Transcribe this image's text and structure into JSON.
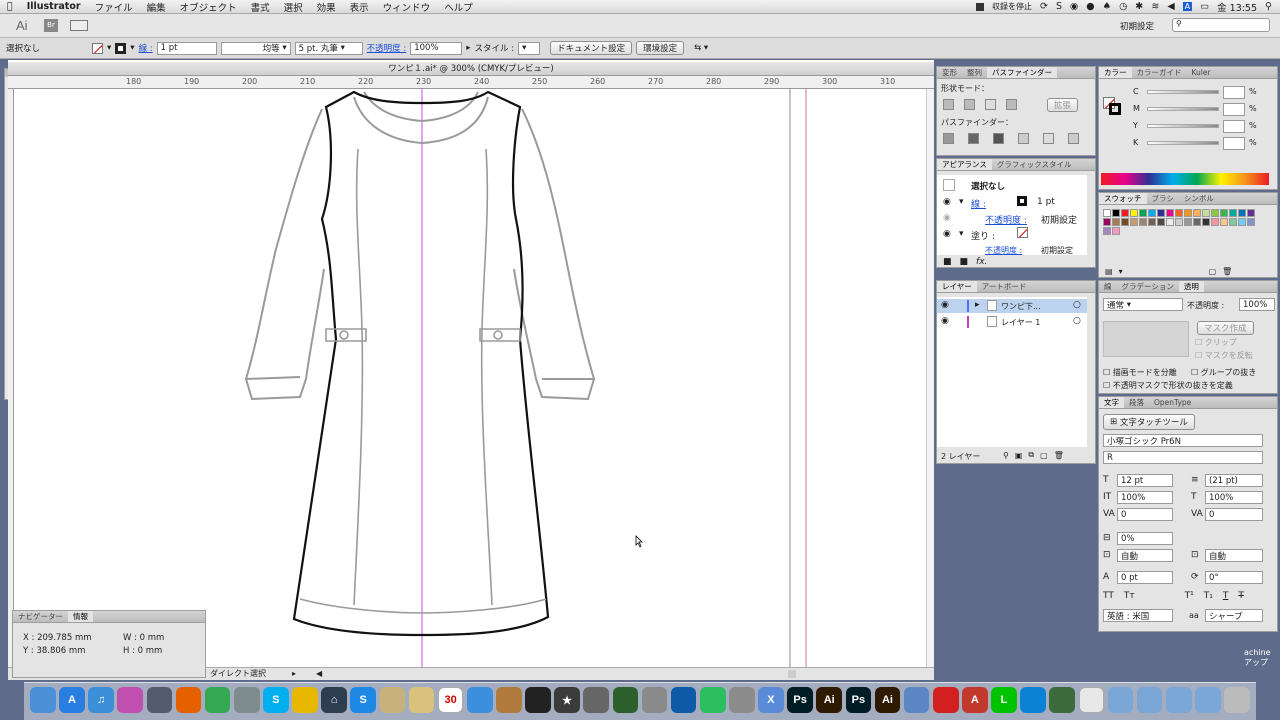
{
  "menubar": {
    "apple_icon": "apple-icon",
    "app": "Illustrator",
    "items": [
      "ファイル",
      "編集",
      "オブジェクト",
      "書式",
      "選択",
      "効果",
      "表示",
      "ウィンドウ",
      "ヘルプ"
    ],
    "recording": "収録を停止",
    "clock": "金 13:55"
  },
  "appbar": {
    "logo": "Ai",
    "workspace": "初期設定",
    "search_placeholder": ""
  },
  "control": {
    "selection": "選択なし",
    "stroke_label": "線 :",
    "stroke_value": "1 pt",
    "stroke_profile": "均等",
    "brush": "5 pt. 丸筆",
    "opacity_label": "不透明度 :",
    "opacity_value": "100%",
    "style_label": "スタイル :",
    "doc_setup": "ドキュメント設定",
    "prefs": "環境設定"
  },
  "document": {
    "title": "ワンピ１.ai* @ 300% (CMYK/プレビュー)",
    "ruler_ticks": [
      "180",
      "190",
      "200",
      "210",
      "220",
      "230",
      "240",
      "250",
      "260",
      "270",
      "280",
      "290",
      "300",
      "310"
    ],
    "status_tool": "ダイレクト選択"
  },
  "pathfinder": {
    "tabs": [
      "変形",
      "整列",
      "パスファインダー"
    ],
    "shape_modes": "形状モード：",
    "expand": "拡張",
    "pathfinders": "パスファインダー："
  },
  "appearance": {
    "tabs": [
      "アピアランス",
      "グラフィックスタイル"
    ],
    "header": "選択なし",
    "stroke_label": "線 :",
    "stroke_value": "1 pt",
    "opacity_label": "不透明度 :",
    "opacity_value": "初期設定",
    "fill_label": "塗り :",
    "opacity2_label": "不透明度 :",
    "opacity2_value": "初期設定"
  },
  "layers": {
    "tabs": [
      "レイヤー",
      "アートボード"
    ],
    "items": [
      {
        "name": "ワンピ下...",
        "color": "#4f6fff"
      },
      {
        "name": "レイヤー 1",
        "color": "#c040c0"
      }
    ],
    "count": "2 レイヤー"
  },
  "color": {
    "tabs": [
      "カラー",
      "カラーガイド",
      "Kuler"
    ],
    "channels": [
      {
        "label": "C",
        "unit": "%"
      },
      {
        "label": "M",
        "unit": "%"
      },
      {
        "label": "Y",
        "unit": "%"
      },
      {
        "label": "K",
        "unit": "%"
      }
    ]
  },
  "swatches": {
    "tabs": [
      "スウォッチ",
      "ブラシ",
      "シンボル"
    ],
    "colors": [
      "#ffffff",
      "#000000",
      "#ed1c24",
      "#fff200",
      "#00a651",
      "#00aeef",
      "#2e3192",
      "#ec008c",
      "#f26522",
      "#f7941d",
      "#fbaf5d",
      "#c4df9b",
      "#8dc63f",
      "#39b54a",
      "#00a99d",
      "#0072bc",
      "#662d91",
      "#9e005d",
      "#a67c52",
      "#754c24",
      "#c69c6d",
      "#998675",
      "#736357",
      "#534741",
      "#ebebeb",
      "#cccccc",
      "#999999",
      "#666666",
      "#333333",
      "#f5989d",
      "#fdc689",
      "#82ca9c",
      "#6dcff6",
      "#8493ca",
      "#a186be",
      "#f49ac1"
    ]
  },
  "transparency": {
    "tabs": [
      "線",
      "グラデーション",
      "透明"
    ],
    "mode": "通常",
    "opacity_label": "不透明度 :",
    "opacity_value": "100%",
    "make_mask": "マスク作成",
    "clip": "クリップ",
    "invert": "マスクを反転",
    "isolate": "描画モードを分離",
    "knockout": "グループの抜き",
    "define": "不透明マスクで形状の抜きを定義"
  },
  "character": {
    "tabs": [
      "文字",
      "段落",
      "OpenType"
    ],
    "touch_tool": "文字タッチツール",
    "font": "小塚ゴシック Pr6N",
    "weight": "R",
    "size": "12 pt",
    "leading": "(21 pt)",
    "vscale": "100%",
    "hscale": "100%",
    "kern": "0",
    "track": "0",
    "tsume": "0%",
    "aki1": "自動",
    "aki2": "自動",
    "baseline": "0 pt",
    "rotate": "0°",
    "lang": "英語 : 米国",
    "aa": "シャープ"
  },
  "info": {
    "tabs": [
      "ナビゲーター",
      "情報"
    ],
    "x": "X : 209.785 mm",
    "y": "Y : 38.806 mm",
    "w": "W : 0 mm",
    "h": "H : 0 mm"
  },
  "dock": {
    "icons": [
      {
        "name": "finder-icon",
        "color": "#4a90d9",
        "t": ""
      },
      {
        "name": "appstore-icon",
        "color": "#2a7de1",
        "t": "A"
      },
      {
        "name": "itunes-icon",
        "color": "#3a8fd8",
        "t": "♫"
      },
      {
        "name": "printer-icon",
        "color": "#c04fb0",
        "t": ""
      },
      {
        "name": "launchpad-icon",
        "color": "#555b6e",
        "t": ""
      },
      {
        "name": "firefox-icon",
        "color": "#e66000",
        "t": ""
      },
      {
        "name": "chrome-icon",
        "color": "#34a853",
        "t": ""
      },
      {
        "name": "preview-icon",
        "color": "#7f8c8d",
        "t": ""
      },
      {
        "name": "skype-icon",
        "color": "#00aff0",
        "t": "S"
      },
      {
        "name": "cyberduck-icon",
        "color": "#e8b800",
        "t": ""
      },
      {
        "name": "home-icon",
        "color": "#2c3e50",
        "t": "⌂"
      },
      {
        "name": "s-app-icon",
        "color": "#1e88e5",
        "t": "S"
      },
      {
        "name": "notes-icon",
        "color": "#c8b27a",
        "t": ""
      },
      {
        "name": "stickies-icon",
        "color": "#d9c27c",
        "t": ""
      },
      {
        "name": "calendar-icon",
        "color": "#ffffff",
        "t": "30"
      },
      {
        "name": "safari-icon",
        "color": "#3b8fdc",
        "t": ""
      },
      {
        "name": "photos-icon",
        "color": "#b07a3c",
        "t": ""
      },
      {
        "name": "clapper-icon",
        "color": "#222222",
        "t": ""
      },
      {
        "name": "star-icon",
        "color": "#3b3b3b",
        "t": "★"
      },
      {
        "name": "camera-icon",
        "color": "#666666",
        "t": ""
      },
      {
        "name": "timemachine-icon",
        "color": "#2d5f2d",
        "t": ""
      },
      {
        "name": "sysprefs-icon",
        "color": "#8a8a8a",
        "t": ""
      },
      {
        "name": "teamviewer-icon",
        "color": "#0e5aa7",
        "t": ""
      },
      {
        "name": "evernote-icon",
        "color": "#2dbe60",
        "t": ""
      },
      {
        "name": "text-app-icon",
        "color": "#8c8c8c",
        "t": ""
      },
      {
        "name": "x-app-icon",
        "color": "#5a8bd8",
        "t": "X"
      },
      {
        "name": "photoshop-icon",
        "color": "#001d26",
        "t": "Ps"
      },
      {
        "name": "illustrator-icon",
        "color": "#2e1a00",
        "t": "Ai"
      },
      {
        "name": "photoshop2-icon",
        "color": "#001d26",
        "t": "Ps"
      },
      {
        "name": "illustrator2-icon",
        "color": "#2e1a00",
        "t": "Ai"
      },
      {
        "name": "installer-icon",
        "color": "#5b86c5",
        "t": ""
      },
      {
        "name": "acrobat-icon",
        "color": "#d31f1f",
        "t": ""
      },
      {
        "name": "a-app-icon",
        "color": "#c0392b",
        "t": "A"
      },
      {
        "name": "line-icon",
        "color": "#00c300",
        "t": "L"
      },
      {
        "name": "upload-icon",
        "color": "#0c82d6",
        "t": ""
      },
      {
        "name": "green-app-icon",
        "color": "#3d6b3d",
        "t": ""
      },
      {
        "name": "document-icon",
        "color": "#e8e8e8",
        "t": ""
      },
      {
        "name": "folder-icon",
        "color": "#7aa7d6",
        "t": ""
      },
      {
        "name": "folder2-icon",
        "color": "#7aa7d6",
        "t": ""
      },
      {
        "name": "folder3-icon",
        "color": "#7aa7d6",
        "t": ""
      },
      {
        "name": "folder4-icon",
        "color": "#7aa7d6",
        "t": ""
      },
      {
        "name": "trash-icon",
        "color": "#bbbbbb",
        "t": ""
      }
    ]
  },
  "desktop_label": "achine\nアップ"
}
